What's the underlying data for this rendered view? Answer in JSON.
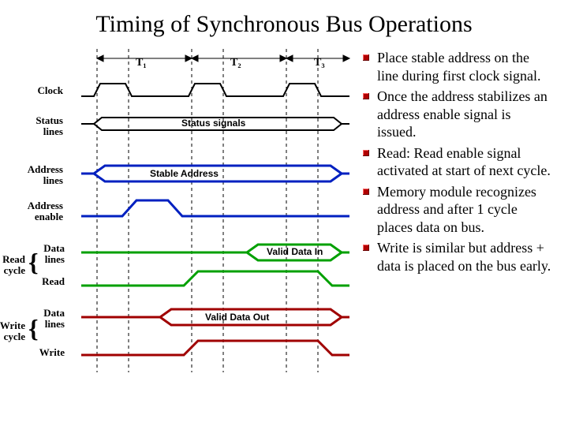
{
  "title": "Timing of Synchronous Bus Operations",
  "cycles": {
    "t1": "T₁",
    "t2": "T₂",
    "t3": "T₃"
  },
  "signals": {
    "clock": "Clock",
    "status": "Status\nlines",
    "address": "Address\nlines",
    "addr_enable": "Address\nenable",
    "read_data": "Data\nlines",
    "read": "Read",
    "write_data": "Data\nlines",
    "write": "Write"
  },
  "groups": {
    "read_cycle": "Read\ncycle",
    "write_cycle": "Write\ncycle"
  },
  "overlays": {
    "status_signals": "Status signals",
    "stable_address": "Stable Address",
    "valid_data_in": "Valid Data In",
    "valid_data_out": "Valid Data Out"
  },
  "bullets": [
    "Place stable address on the line during first clock signal.",
    "Once the address stabilizes an address enable signal is issued.",
    "Read:  Read enable signal activated at start of next cycle.",
    "Memory module recognizes address and after 1 cycle places data on bus.",
    "Write is similar but address + data is placed on the bus early."
  ]
}
